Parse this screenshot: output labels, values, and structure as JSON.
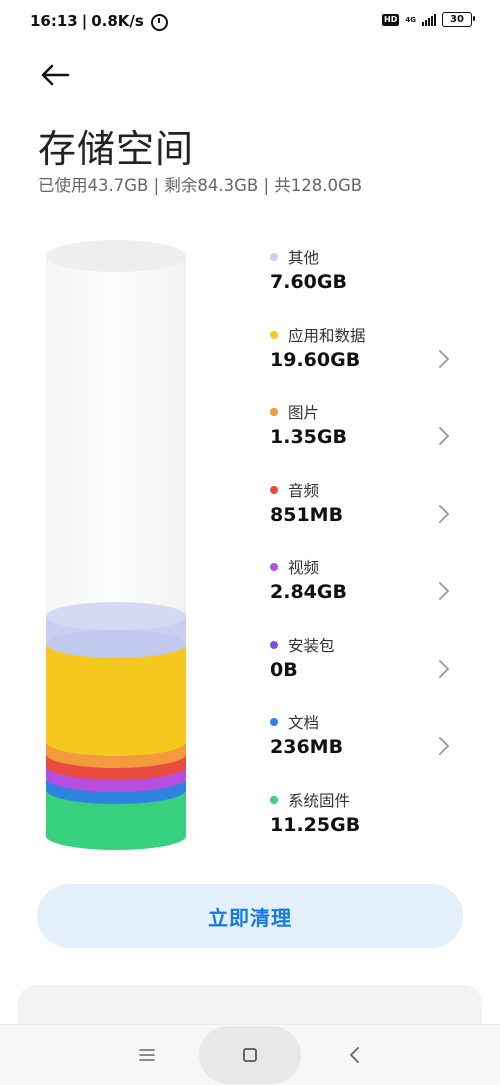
{
  "status_bar": {
    "time": "16:13",
    "speed": "0.8K/s",
    "hd": "HD",
    "network": "4G",
    "battery": "30"
  },
  "header": {
    "title": "存储空间",
    "summary": "已使用43.7GB | 剩余84.3GB | 共128.0GB"
  },
  "categories": [
    {
      "label": "其他",
      "value": "7.60GB",
      "color": "#c9cff0"
    },
    {
      "label": "应用和数据",
      "value": "19.60GB",
      "color": "#f4c81e"
    },
    {
      "label": "图片",
      "value": "1.35GB",
      "color": "#f29a3c"
    },
    {
      "label": "音频",
      "value": "851MB",
      "color": "#ea4b3f"
    },
    {
      "label": "视频",
      "value": "2.84GB",
      "color": "#b84ee0"
    },
    {
      "label": "安装包",
      "value": "0B",
      "color": "#7a4fe0"
    },
    {
      "label": "文档",
      "value": "236MB",
      "color": "#2f83e0"
    },
    {
      "label": "系统固件",
      "value": "11.25GB",
      "color": "#36d07e"
    }
  ],
  "actions": {
    "clean_label": "立即清理"
  },
  "colors": {
    "accent": "#1779dc",
    "button_bg": "#e3f0fc"
  }
}
